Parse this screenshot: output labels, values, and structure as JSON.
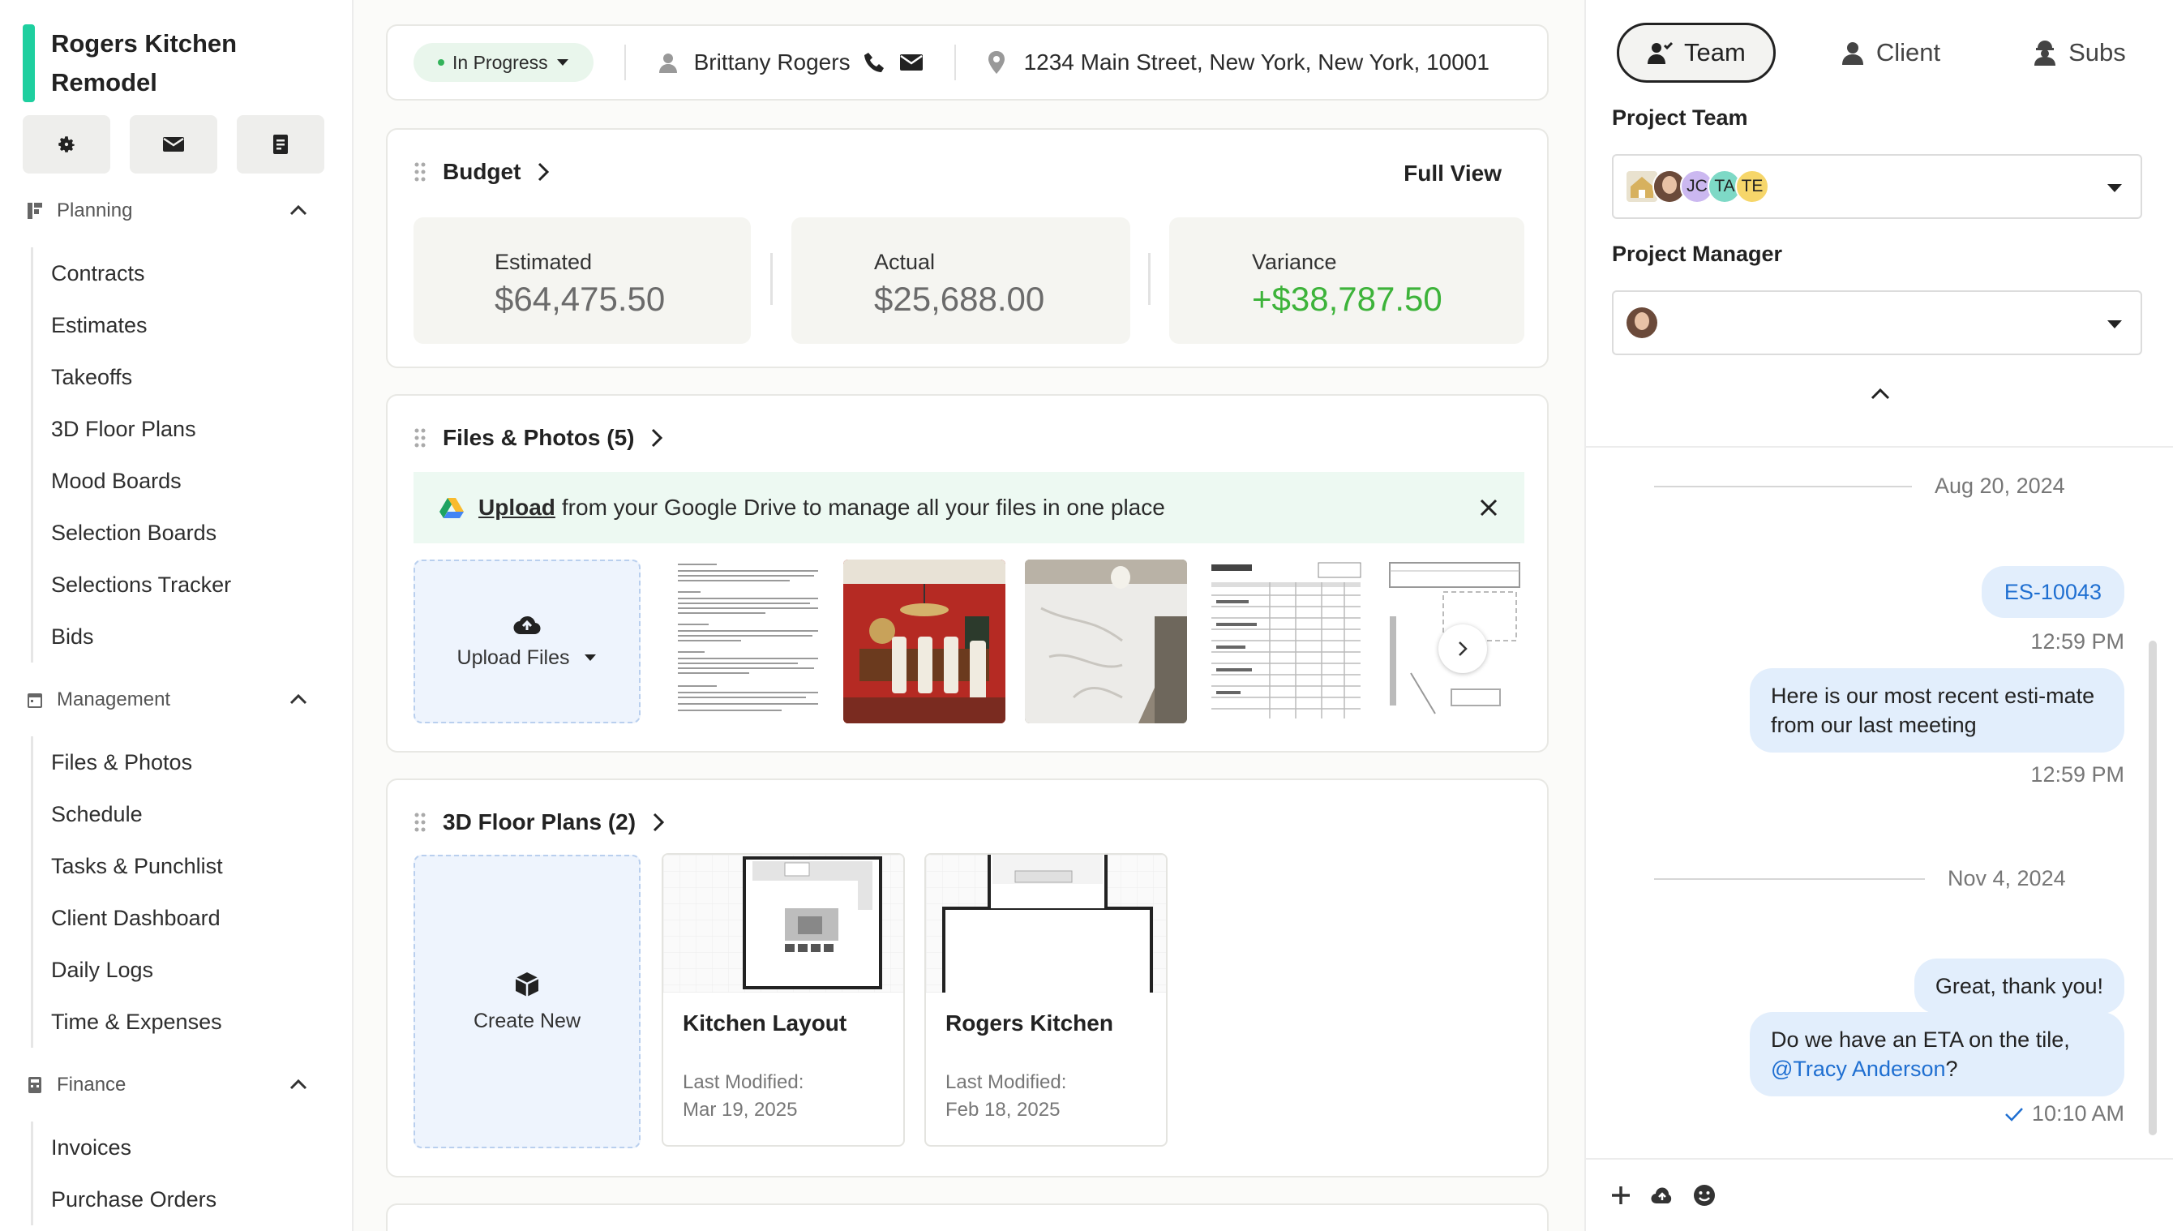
{
  "sidebar": {
    "project_title": "Rogers Kitchen Remodel",
    "top_buttons": [
      "gear-icon",
      "envelope-icon",
      "clipboard-icon"
    ],
    "sections": [
      {
        "title": "Planning",
        "items": [
          "Contracts",
          "Estimates",
          "Takeoffs",
          "3D Floor Plans",
          "Mood Boards",
          "Selection Boards",
          "Selections Tracker",
          "Bids"
        ]
      },
      {
        "title": "Management",
        "items": [
          "Files & Photos",
          "Schedule",
          "Tasks & Punchlist",
          "Client Dashboard",
          "Daily Logs",
          "Time & Expenses"
        ]
      },
      {
        "title": "Finance",
        "items": [
          "Invoices",
          "Purchase Orders"
        ]
      }
    ]
  },
  "header": {
    "status": "In Progress",
    "client_name": "Brittany Rogers",
    "address": "1234 Main Street, New York, New York, 10001"
  },
  "budget": {
    "title": "Budget",
    "full_view": "Full View",
    "estimated_label": "Estimated",
    "estimated_value": "$64,475.50",
    "actual_label": "Actual",
    "actual_value": "$25,688.00",
    "variance_label": "Variance",
    "variance_value": "+$38,787.50",
    "variance_color": "#3db33a"
  },
  "files": {
    "title": "Files & Photos (5)",
    "banner_link": "Upload",
    "banner_text": "from your Google Drive to manage all your files in one place",
    "upload_label": "Upload Files"
  },
  "floor_plans": {
    "title": "3D Floor Plans (2)",
    "create_label": "Create New",
    "cards": [
      {
        "name": "Kitchen Layout",
        "modified_label": "Last Modified:",
        "modified_date": "Mar 19, 2025"
      },
      {
        "name": "Rogers Kitchen",
        "modified_label": "Last Modified:",
        "modified_date": "Feb 18, 2025"
      }
    ]
  },
  "right_panel": {
    "tabs": [
      "Team",
      "Client",
      "Subs"
    ],
    "project_team_label": "Project Team",
    "team_initials": [
      "JC",
      "TA",
      "TE"
    ],
    "team_colors": [
      "#cbb8f0",
      "#7ed9c6",
      "#f6d66a"
    ],
    "project_manager_label": "Project Manager"
  },
  "chat": {
    "date1": "Aug 20, 2024",
    "msg1": "ES-10043",
    "time1": "12:59 PM",
    "msg2": "Here is our most recent esti-mate from our last meeting",
    "time2": "12:59 PM",
    "date2": "Nov 4, 2024",
    "msg3": "Great, thank you!",
    "msg4": "Do we have an ETA on the tile,",
    "msg4_mention": "@Tracy Anderson",
    "msg4_end": "?",
    "time4": "10:10 AM",
    "link_color": "#1f6fd1"
  }
}
